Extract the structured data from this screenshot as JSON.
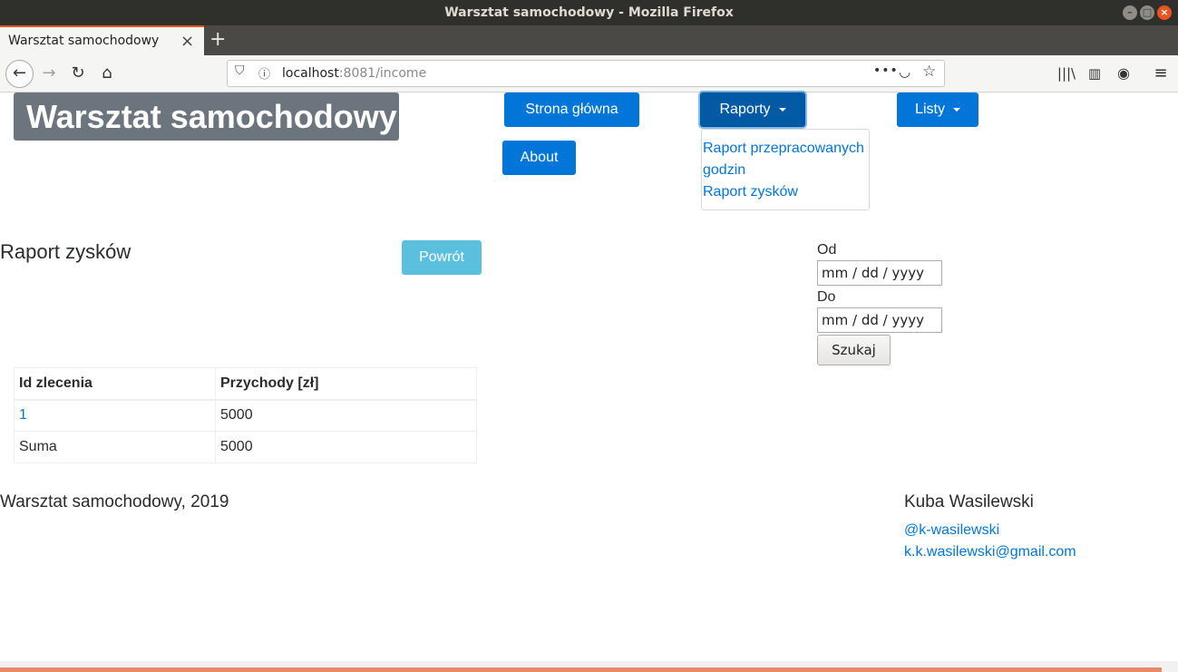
{
  "window": {
    "title": "Warsztat samochodowy - Mozilla Firefox",
    "min_glyph": "–",
    "max_glyph": "□",
    "close_glyph": "×"
  },
  "tab": {
    "title": "Warsztat samochodowy",
    "close_glyph": "×",
    "new_tab_glyph": "+"
  },
  "nav": {
    "back_glyph": "←",
    "forward_glyph": "→",
    "reload_glyph": "↻",
    "home_glyph": "⌂",
    "url_host": "localhost",
    "url_rest": ":8081/income",
    "more_glyph": "•••",
    "pocket_glyph": "◡",
    "star_glyph": "☆",
    "library_glyph": "|||\\",
    "sidebar_glyph": "▥",
    "account_glyph": "◉",
    "menu_glyph": "≡",
    "shield_glyph": "⛉",
    "info_glyph": "ⓘ"
  },
  "header": {
    "brand": "Warsztat samochodowy",
    "home_label": "Strona główna",
    "about_label": "About",
    "reports_label": "Raporty",
    "lists_label": "Listy",
    "reports_menu": [
      "Raport przepracowanych godzin",
      "Raport zysków"
    ]
  },
  "report": {
    "heading": "Raport zysków",
    "back_label": "Powrót",
    "from_label": "Od",
    "from_placeholder": "mm / dd / yyyy",
    "to_label": "Do",
    "to_placeholder": "mm / dd / yyyy",
    "search_label": "Szukaj"
  },
  "table": {
    "columns": [
      "Id zlecenia",
      "Przychody [zł]"
    ],
    "rows": [
      {
        "id": "1",
        "income": "5000"
      }
    ],
    "sum_label": "Suma",
    "sum_value": "5000"
  },
  "footer": {
    "copyright": "Warsztat samochodowy, 2019",
    "author": "Kuba Wasilewski",
    "handle": "@k-wasilewski",
    "email": "k.k.wasilewski@gmail.com"
  },
  "colors": {
    "primary": "#0275d8",
    "info": "#5bc0de",
    "brand_bg": "#6c757d",
    "ubuntu_orange": "#e95420"
  }
}
